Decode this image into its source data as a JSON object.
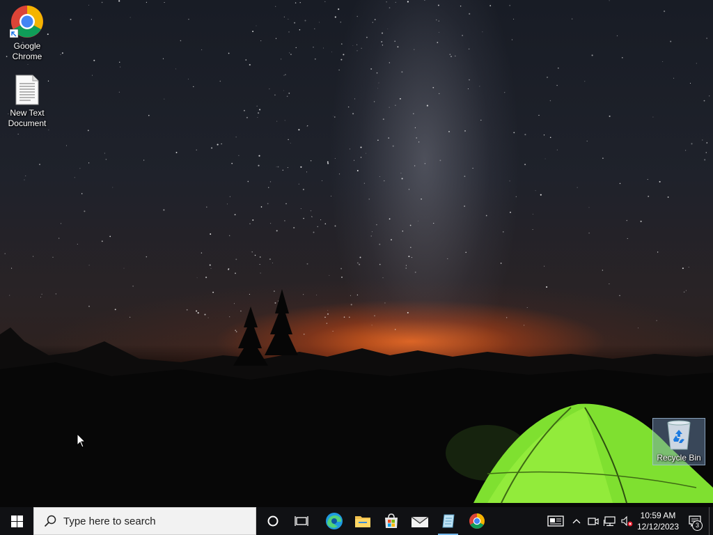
{
  "desktop": {
    "icons": [
      {
        "label": "Google\nChrome",
        "icon": "chrome-icon"
      },
      {
        "label": "New Text\nDocument",
        "icon": "text-document-icon"
      },
      {
        "label": "Recycle Bin",
        "icon": "recycle-bin-icon"
      }
    ]
  },
  "taskbar": {
    "search_placeholder": "Type here to search",
    "buttons": [
      {
        "name": "cortana",
        "icon": "cortana-circle-icon"
      },
      {
        "name": "task-view",
        "icon": "task-view-icon"
      },
      {
        "name": "edge",
        "icon": "edge-icon"
      },
      {
        "name": "file-explorer",
        "icon": "folder-icon"
      },
      {
        "name": "microsoft-store",
        "icon": "store-bag-icon"
      },
      {
        "name": "mail",
        "icon": "mail-icon"
      },
      {
        "name": "notepad",
        "icon": "notepad-icon"
      },
      {
        "name": "chrome",
        "icon": "chrome-icon"
      }
    ],
    "tray": {
      "time": "10:59 AM",
      "date": "12/12/2023",
      "notification_count": "3"
    }
  },
  "colors": {
    "taskbar_bg": "#101114",
    "accent": "#76b9ed",
    "tent_green": "#7fe030"
  }
}
